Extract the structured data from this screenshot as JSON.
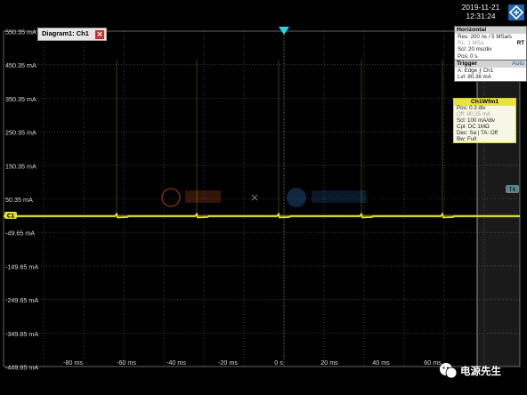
{
  "header": {
    "date": "2019-11-21",
    "time": "12:31:24"
  },
  "diagram_tab": {
    "label": "Diagram1: Ch1",
    "close_icon": "close-icon"
  },
  "horizontal": {
    "title": "Horizontal",
    "rows": [
      {
        "text": "Res: 200 ns / 5 MSa/s",
        "dim": false
      },
      {
        "text": "RL:  1 MSa",
        "dim": true,
        "badge": "RT"
      },
      {
        "text": "Scl:  20 ms/div",
        "dim": false
      },
      {
        "text": "Pos: 0 s",
        "dim": false
      }
    ]
  },
  "trigger": {
    "title": "Trigger",
    "mode": "Auto",
    "rows": [
      {
        "text": "A:    Edge  ⨍  Ch1"
      },
      {
        "text": "Lvl:   80.36 mA"
      }
    ]
  },
  "channel": {
    "title": "Ch1Wfm1",
    "rows": [
      {
        "text": "Pos: 0.3 div",
        "dim": false
      },
      {
        "text": "Off:  80.35 mA",
        "dim": true
      },
      {
        "text": "Scl:  100 mA/div",
        "dim": false
      },
      {
        "text": "Cpl: DC 1MΩ",
        "dim": false
      },
      {
        "text": "Dec: Sa | TA: Off",
        "dim": false
      },
      {
        "text": "Bw: Full",
        "dim": false
      }
    ]
  },
  "y_tick_labels": [
    "550.35 mA",
    "450.35 mA",
    "350.35 mA",
    "250.35 mA",
    "150.35 mA",
    "50.35 mA",
    "-49.65 mA",
    "-149.65 mA",
    "-249.65 mA",
    "-349.65 mA",
    "-449.65 mA"
  ],
  "x_tick_labels": [
    "-80 ms",
    "-60 ms",
    "-40 ms",
    "-20 ms",
    "0 s",
    "20 ms",
    "40 ms",
    "60 ms"
  ],
  "channel_marker": "C1",
  "trigger_marker": "T4",
  "watermark": {
    "text": "电源先生"
  },
  "colors": {
    "trace": "#e3e02c",
    "grid": "#5a5a5a",
    "panel_header": "#d4d4d4",
    "channel_header": "#e8e43a"
  }
}
